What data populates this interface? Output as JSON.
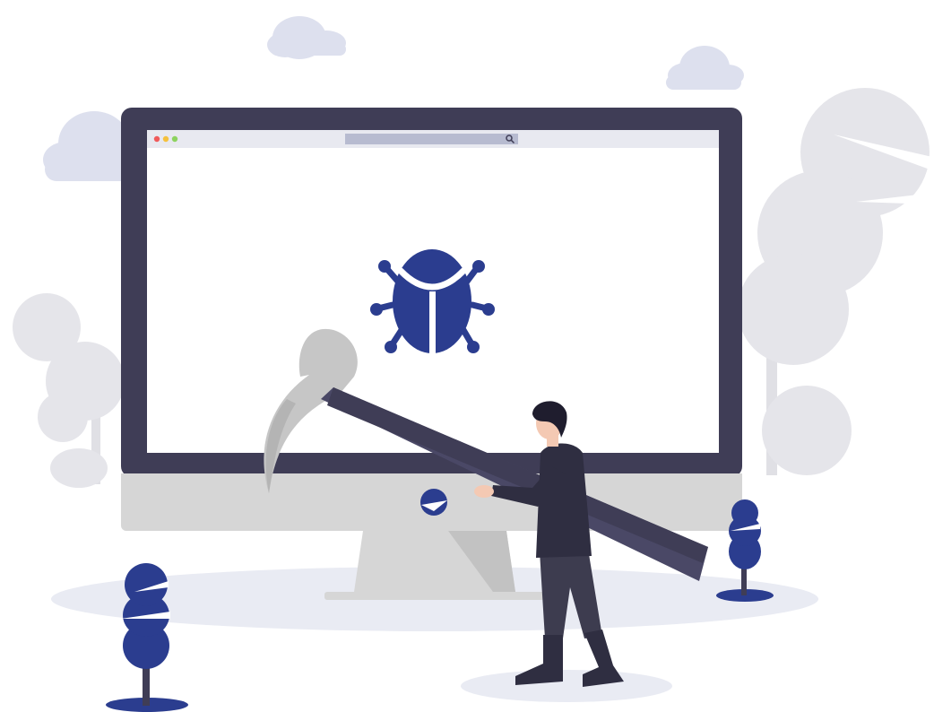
{
  "illustration": {
    "subject": "bug-fixing",
    "elements": [
      "monitor",
      "browser-window",
      "bug-icon",
      "hammer",
      "person",
      "plants",
      "clouds"
    ]
  },
  "browser": {
    "window_controls": [
      "close",
      "minimize",
      "maximize"
    ],
    "search_icon": "search-icon",
    "search_value": ""
  },
  "colors": {
    "accent": "#2b3d8f",
    "monitor_frame": "#3f3d56",
    "screen": "#ffffff",
    "toolbar": "#e8e9f0",
    "search_bar": "#b7bbd0",
    "stand": "#d6d6d6",
    "ground": "#e9ebf3",
    "foliage": "#e5e5ea",
    "cloud": "#dde0ee",
    "hammer_head": "#c6c6c6",
    "hammer_handle": "#4a4866",
    "skin": "#f4c9b3",
    "hair": "#1f1d2e",
    "shirt": "#2f2e41",
    "pants": "#3d3c4f",
    "dot_red": "#f05a5a",
    "dot_yellow": "#f5c13d",
    "dot_green": "#8dd35f"
  }
}
